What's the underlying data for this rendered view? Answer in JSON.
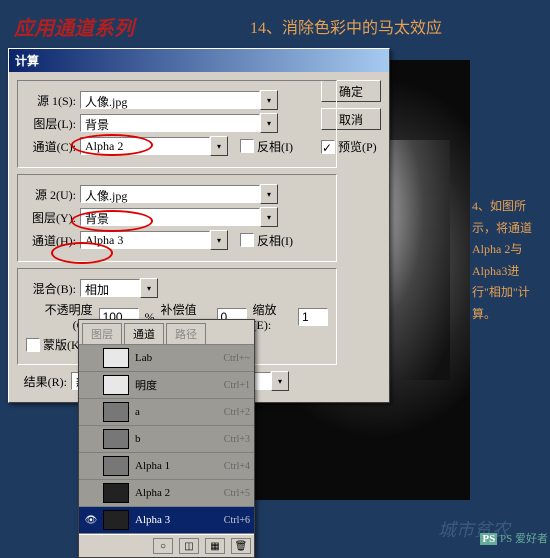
{
  "series_title": "应用通道系列",
  "page_title": "14、消除色彩中的马太效应",
  "side_note": "4、如图所示，将通道Alpha 2与Alpha3进行\"相加\"计算。",
  "dialog": {
    "title": "计算",
    "source1_label": "源 1(S):",
    "source1_value": "人像.jpg",
    "layer1_label": "图层(L):",
    "layer1_value": "背景",
    "channel1_label": "通道(C):",
    "channel1_value": "Alpha 2",
    "invert1_label": "反相(I)",
    "source2_label": "源 2(U):",
    "source2_value": "人像.jpg",
    "layer2_label": "图层(Y):",
    "layer2_value": "背景",
    "channel2_label": "通道(H):",
    "channel2_value": "Alpha 3",
    "invert2_label": "反相(I)",
    "blend_label": "混合(B):",
    "blend_value": "相加",
    "opacity_label": "不透明度(O):",
    "opacity_value": "100",
    "opacity_suffix": "%",
    "offset_label": "补偿值(F):",
    "offset_value": "0",
    "scale_label": "缩放(E):",
    "scale_value": "1",
    "mask_label": "蒙版(K)...",
    "result_label": "结果(R):",
    "result_value": "新建通道",
    "ok": "确定",
    "cancel": "取消",
    "preview": "预览(P)"
  },
  "channels": {
    "tab1": "图层",
    "tab2": "通道",
    "tab3": "路径",
    "items": [
      {
        "name": "Lab",
        "key": "Ctrl+~",
        "thumb": "light",
        "eye": ""
      },
      {
        "name": "明度",
        "key": "Ctrl+1",
        "thumb": "light",
        "eye": ""
      },
      {
        "name": "a",
        "key": "Ctrl+2",
        "thumb": "mid",
        "eye": ""
      },
      {
        "name": "b",
        "key": "Ctrl+3",
        "thumb": "mid",
        "eye": ""
      },
      {
        "name": "Alpha 1",
        "key": "Ctrl+4",
        "thumb": "mid",
        "eye": ""
      },
      {
        "name": "Alpha 2",
        "key": "Ctrl+5",
        "thumb": "dark",
        "eye": ""
      },
      {
        "name": "Alpha 3",
        "key": "Ctrl+6",
        "thumb": "dark",
        "eye": "👁",
        "sel": true
      }
    ]
  },
  "watermark": "城市贫农",
  "logo_text": "PS 爱好者"
}
